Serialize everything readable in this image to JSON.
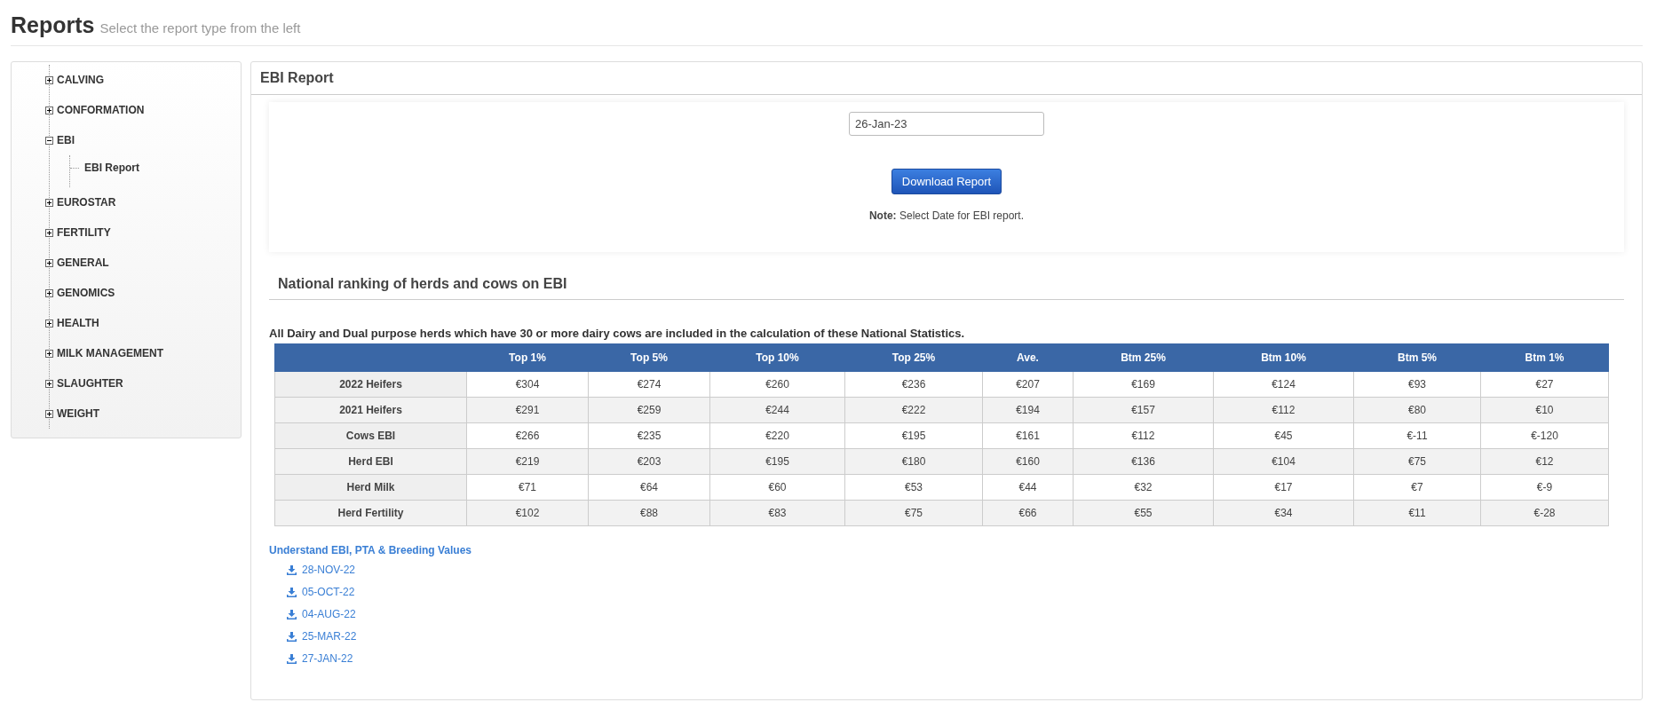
{
  "page_header": {
    "title": "Reports",
    "subtitle": "Select the report type from the left"
  },
  "sidebar": {
    "tree": [
      {
        "label": "CALVING",
        "expanded": false
      },
      {
        "label": "CONFORMATION",
        "expanded": false
      },
      {
        "label": "EBI",
        "expanded": true,
        "children": [
          {
            "label": "EBI Report"
          }
        ]
      },
      {
        "label": "EUROSTAR",
        "expanded": false
      },
      {
        "label": "FERTILITY",
        "expanded": false
      },
      {
        "label": "GENERAL",
        "expanded": false
      },
      {
        "label": "GENOMICS",
        "expanded": false
      },
      {
        "label": "HEALTH",
        "expanded": false
      },
      {
        "label": "MILK MANAGEMENT",
        "expanded": false
      },
      {
        "label": "SLAUGHTER",
        "expanded": false
      },
      {
        "label": "WEIGHT",
        "expanded": false
      }
    ]
  },
  "panel": {
    "title": "EBI Report",
    "form": {
      "date_field": {
        "value": "26-Jan-23"
      },
      "button": "Download Report",
      "note": "**Note:** Select Date for EBI report."
    },
    "section_title": "National ranking of herds and cows on EBI",
    "description": "All Dairy and Dual purpose herds which have 30 or more dairy cows are included in the calculation of these National Statistics.",
    "table": {
      "columns": [
        "",
        "Top 1%",
        "Top 5%",
        "Top 10%",
        "Top 25%",
        "Ave.",
        "Btm 25%",
        "Btm 10%",
        "Btm 5%",
        "Btm 1%"
      ],
      "rows": [
        [
          "2022 Heifers",
          "€304",
          "€274",
          "€260",
          "€236",
          "€207",
          "€169",
          "€124",
          "€93",
          "€27"
        ],
        [
          "2021 Heifers",
          "€291",
          "€259",
          "€244",
          "€222",
          "€194",
          "€157",
          "€112",
          "€80",
          "€10"
        ],
        [
          "Cows EBI",
          "€266",
          "€235",
          "€220",
          "€195",
          "€161",
          "€112",
          "€45",
          "€-11",
          "€-120"
        ],
        [
          "Herd EBI",
          "€219",
          "€203",
          "€195",
          "€180",
          "€160",
          "€136",
          "€104",
          "€75",
          "€12"
        ],
        [
          "Herd Milk",
          "€71",
          "€64",
          "€60",
          "€53",
          "€44",
          "€32",
          "€17",
          "€7",
          "€-9"
        ],
        [
          "Herd Fertility",
          "€102",
          "€88",
          "€83",
          "€75",
          "€66",
          "€55",
          "€34",
          "€11",
          "€-28"
        ]
      ]
    },
    "info_link": "Understand EBI, PTA & Breeding Values",
    "downloads": [
      "28-NOV-22",
      "05-OCT-22",
      "04-AUG-22",
      "25-MAR-22",
      "27-JAN-22"
    ]
  }
}
